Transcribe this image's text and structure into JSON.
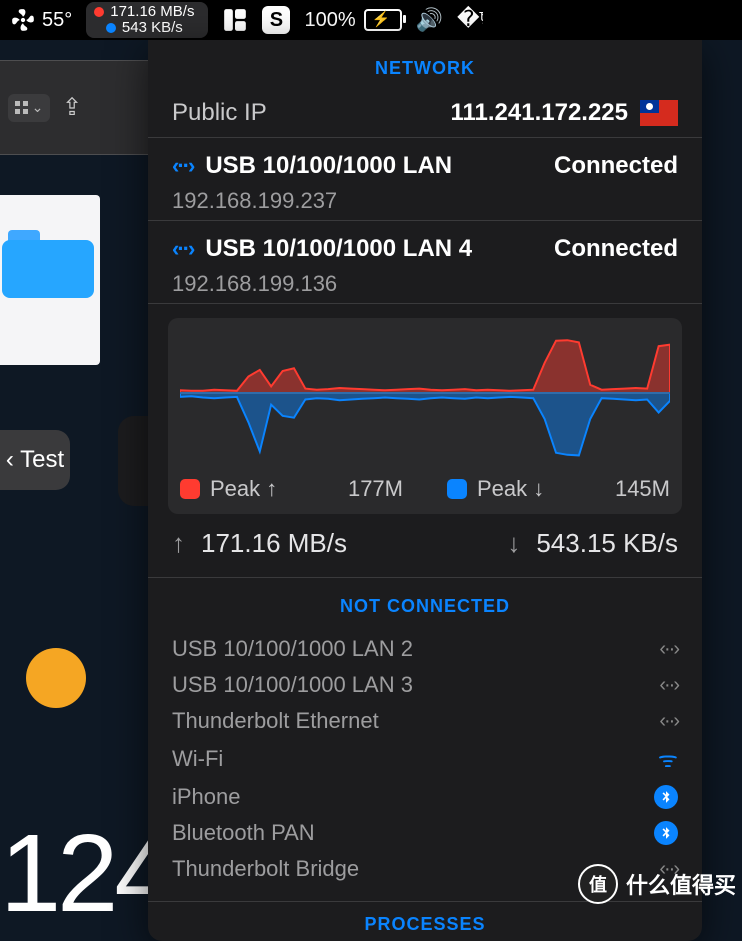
{
  "menubar": {
    "temp": "55°",
    "net_up": "171.16 MB/s",
    "net_down": "543 KB/s",
    "battery_pct": "100%"
  },
  "background": {
    "test_button": "‹ Test",
    "clock_fragment": "124"
  },
  "panel": {
    "section_network": "NETWORK",
    "public_ip_label": "Public IP",
    "public_ip_value": "111.241.172.225",
    "interfaces": [
      {
        "name": "USB 10/100/1000 LAN",
        "status": "Connected",
        "ip": "192.168.199.237"
      },
      {
        "name": "USB 10/100/1000 LAN 4",
        "status": "Connected",
        "ip": "192.168.199.136"
      }
    ],
    "peak_up_label": "Peak ↑",
    "peak_up_value": "177M",
    "peak_down_label": "Peak ↓",
    "peak_down_value": "145M",
    "rate_up": "171.16 MB/s",
    "rate_down": "543.15 KB/s",
    "section_not_connected": "NOT CONNECTED",
    "not_connected": [
      {
        "name": "USB 10/100/1000 LAN 2",
        "icon": "link"
      },
      {
        "name": "USB 10/100/1000 LAN 3",
        "icon": "link"
      },
      {
        "name": "Thunderbolt Ethernet",
        "icon": "link"
      },
      {
        "name": "Wi-Fi",
        "icon": "wifi"
      },
      {
        "name": "iPhone",
        "icon": "bt"
      },
      {
        "name": "Bluetooth PAN",
        "icon": "bt"
      },
      {
        "name": "Thunderbolt Bridge",
        "icon": "link"
      }
    ],
    "section_processes": "PROCESSES"
  },
  "watermark": {
    "text": "什么值得买",
    "badge": "值"
  },
  "chart_data": {
    "type": "area",
    "series": [
      {
        "name": "upload",
        "dir": "up",
        "color": "#ff3b30",
        "peak_label": "177M",
        "values": [
          5,
          4,
          4,
          6,
          5,
          4,
          30,
          42,
          12,
          40,
          45,
          8,
          6,
          7,
          9,
          8,
          7,
          6,
          5,
          6,
          7,
          8,
          6,
          5,
          6,
          7,
          5,
          6,
          5,
          4,
          5,
          6,
          55,
          95,
          96,
          92,
          15,
          6,
          7,
          8,
          9,
          8,
          85,
          88
        ]
      },
      {
        "name": "download",
        "dir": "down",
        "color": "#0a84ff",
        "peak_label": "145M",
        "values": [
          6,
          5,
          7,
          8,
          7,
          6,
          45,
          90,
          18,
          35,
          38,
          10,
          8,
          9,
          11,
          10,
          9,
          8,
          7,
          8,
          9,
          10,
          8,
          7,
          8,
          9,
          7,
          8,
          7,
          6,
          7,
          8,
          40,
          92,
          95,
          96,
          40,
          8,
          9,
          10,
          11,
          10,
          30,
          12
        ]
      }
    ],
    "xlabel": "",
    "ylabel": "",
    "title": ""
  }
}
